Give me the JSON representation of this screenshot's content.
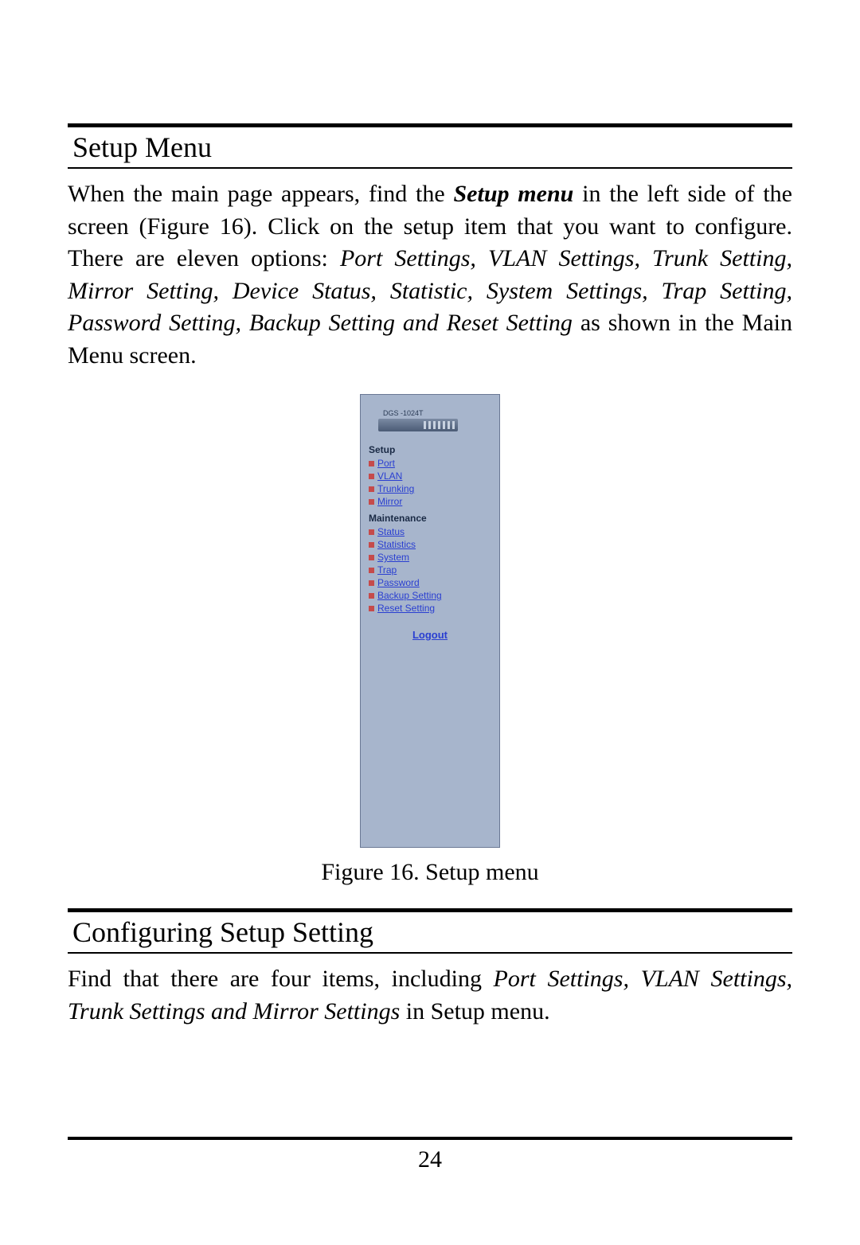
{
  "section1": {
    "heading": "Setup Menu",
    "para_parts": {
      "p1a": "When the main page appears, find the ",
      "p1b": "Setup menu",
      "p1c": " in the left side of the screen (Figure 16). Click on the setup item that you want to configure. There are eleven options: ",
      "p1d": "Port Settings, VLAN Settings, Trunk Setting, Mirror Setting, Device Status, Statistic, System Settings, Trap Setting, Password Setting, Backup Setting and Reset Setting",
      "p1e": " as shown in the Main Menu screen."
    }
  },
  "screenshot": {
    "device_label": "DGS -1024T",
    "setup_header": "Setup",
    "setup_items": [
      "Port",
      "VLAN",
      "Trunking",
      "Mirror"
    ],
    "maintenance_header": "Maintenance",
    "maintenance_items": [
      "Status",
      "Statistics",
      "System",
      "Trap",
      "Password",
      "Backup Setting",
      "Reset Setting"
    ],
    "logout": "Logout"
  },
  "figure_caption": "Figure 16. Setup menu",
  "section2": {
    "heading": "Configuring Setup Setting",
    "para_parts": {
      "p2a": "Find that there are four items, including ",
      "p2b": "Port Settings, VLAN Settings, Trunk Settings and Mirror Settings",
      "p2c": " in Setup menu."
    }
  },
  "page_number": "24"
}
